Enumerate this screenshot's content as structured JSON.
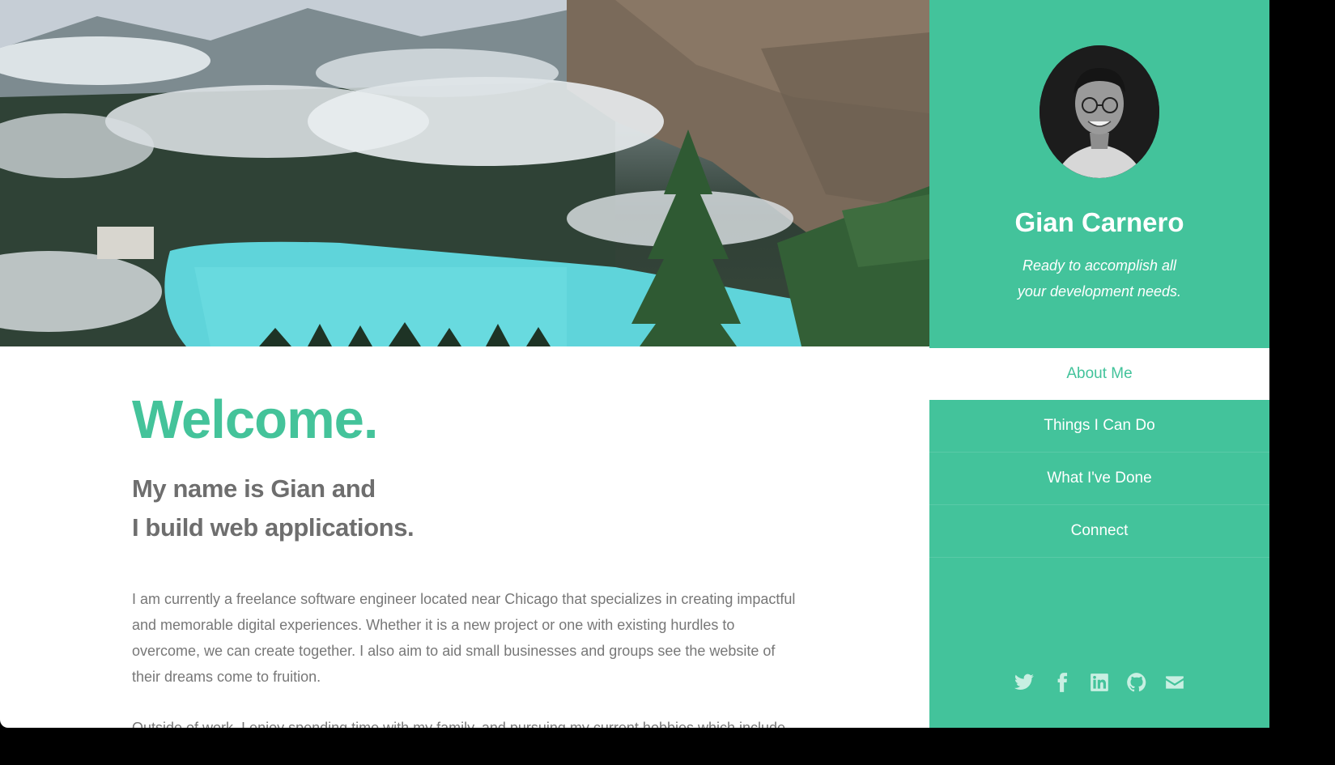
{
  "hero": {
    "alt": "Mountain lake landscape"
  },
  "main": {
    "heading": "Welcome.",
    "intro_line1": "My name is Gian and",
    "intro_line2": "I build web applications.",
    "paragraph1": "I am currently a freelance software engineer located near Chicago that specializes in creating impactful and memorable digital experiences. Whether it is a new project or one with existing hurdles to overcome, we can create together. I also aim to aid small businesses and groups see the website of their dreams come to fruition.",
    "paragraph2": "Outside of work, I enjoy spending time with my family, and pursuing my current hobbies which include"
  },
  "sidebar": {
    "name": "Gian Carnero",
    "tagline_line1": "Ready to accomplish all",
    "tagline_line2": "your development needs.",
    "nav": [
      {
        "label": "About Me",
        "active": true
      },
      {
        "label": "Things I Can Do",
        "active": false
      },
      {
        "label": "What I've Done",
        "active": false
      },
      {
        "label": "Connect",
        "active": false
      }
    ],
    "social": [
      "twitter-icon",
      "facebook-icon",
      "linkedin-icon",
      "github-icon",
      "email-icon"
    ]
  },
  "colors": {
    "accent": "#43c39b",
    "text": "#777777",
    "heading_gray": "#6e6e6e"
  }
}
